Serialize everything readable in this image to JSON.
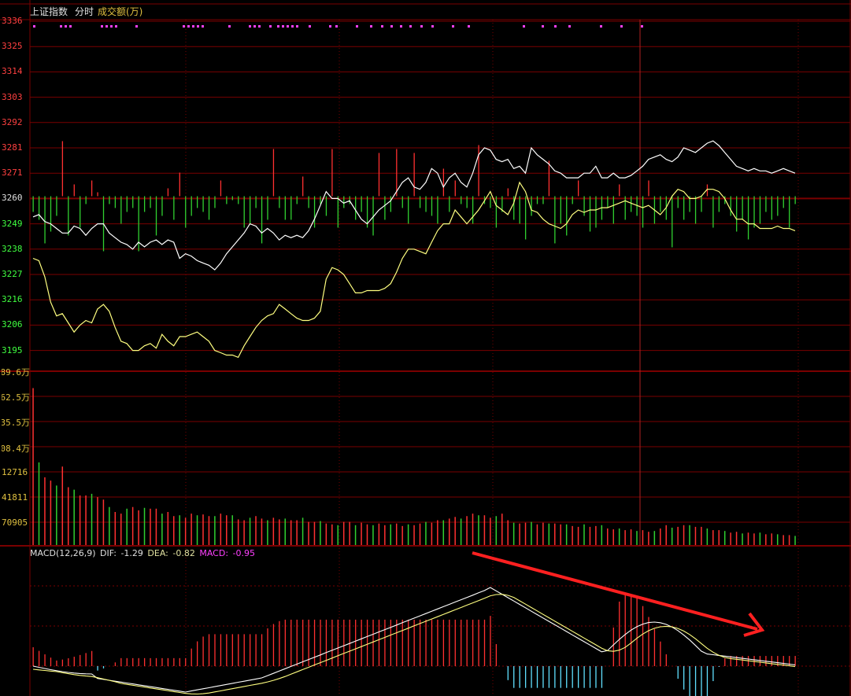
{
  "header": {
    "index_name": "上证指数",
    "mode": "分时",
    "volume_label": "成交额(万)"
  },
  "colors": {
    "background": "#000000",
    "grid": "#7a0000",
    "axis_red": "#ff4040",
    "axis_green": "#40ff40",
    "axis_yellow": "#e0c040",
    "price_line": "#ffffff",
    "avg_line": "#ffff80",
    "bar_up": "#ff3030",
    "bar_down": "#30d030",
    "macd_neg": "#60e0ff",
    "macd_pos": "#ff3030",
    "dots": "#ff40ff",
    "arrow": "#ff2020"
  },
  "macd_legend": {
    "name": "MACD(12,26,9)",
    "dif_label": "DIF:",
    "dif_value": "-1.29",
    "dea_label": "DEA:",
    "dea_value": "-0.82",
    "macd_label": "MACD:",
    "macd_value": "-0.95"
  },
  "chart_data": [
    {
      "type": "line",
      "panel": "price",
      "y_ticks": [
        "3336",
        "3325",
        "3314",
        "3303",
        "3292",
        "3281",
        "3271",
        "3260",
        "3249",
        "3238",
        "3227",
        "3216",
        "3206",
        "3195"
      ],
      "ylim": [
        3190,
        3336
      ],
      "base": 3260,
      "series": [
        {
          "role": "price_white",
          "values": [
            3251,
            3252,
            3249,
            3248,
            3246,
            3244,
            3244,
            3247,
            3246,
            3243,
            3246,
            3248,
            3248,
            3244,
            3242,
            3240,
            3239,
            3237,
            3240,
            3238,
            3240,
            3241,
            3239,
            3241,
            3240,
            3233,
            3235,
            3234,
            3232,
            3231,
            3230,
            3228,
            3231,
            3235,
            3238,
            3241,
            3244,
            3248,
            3247,
            3244,
            3246,
            3244,
            3241,
            3243,
            3242,
            3243,
            3242,
            3245,
            3250,
            3256,
            3262,
            3259,
            3259,
            3257,
            3258,
            3254,
            3250,
            3248,
            3251,
            3254,
            3256,
            3258,
            3262,
            3266,
            3268,
            3264,
            3263,
            3266,
            3272,
            3270,
            3264,
            3268,
            3270,
            3266,
            3264,
            3270,
            3278,
            3281,
            3280,
            3276,
            3275,
            3276,
            3272,
            3273,
            3270,
            3281,
            3278,
            3276,
            3274,
            3271,
            3270,
            3268,
            3268,
            3268,
            3270,
            3270,
            3273,
            3268,
            3268,
            3270,
            3268,
            3268,
            3269,
            3271,
            3273,
            3276,
            3277,
            3278,
            3276,
            3275,
            3277,
            3281,
            3280,
            3279,
            3281,
            3283,
            3284,
            3282,
            3279,
            3276,
            3273,
            3272,
            3271,
            3272,
            3271,
            3271,
            3270,
            3271,
            3272,
            3271,
            3270
          ]
        },
        {
          "role": "price_yellow",
          "values": [
            3233,
            3232,
            3225,
            3214,
            3208,
            3209,
            3205,
            3201,
            3204,
            3206,
            3205,
            3211,
            3213,
            3210,
            3203,
            3197,
            3196,
            3193,
            3193,
            3195,
            3196,
            3194,
            3200,
            3197,
            3195,
            3199,
            3199,
            3200,
            3201,
            3199,
            3197,
            3193,
            3192,
            3191,
            3191,
            3190,
            3195,
            3199,
            3203,
            3206,
            3208,
            3209,
            3213,
            3211,
            3209,
            3207,
            3206,
            3206,
            3207,
            3210,
            3224,
            3229,
            3228,
            3226,
            3222,
            3218,
            3218,
            3219,
            3219,
            3219,
            3220,
            3222,
            3227,
            3233,
            3237,
            3237,
            3236,
            3235,
            3240,
            3245,
            3248,
            3248,
            3254,
            3251,
            3248,
            3251,
            3254,
            3258,
            3262,
            3256,
            3254,
            3252,
            3257,
            3266,
            3262,
            3254,
            3253,
            3250,
            3248,
            3247,
            3246,
            3248,
            3252,
            3254,
            3253,
            3254,
            3254,
            3255,
            3255,
            3256,
            3257,
            3258,
            3257,
            3256,
            3255,
            3256,
            3254,
            3252,
            3255,
            3260,
            3263,
            3262,
            3259,
            3259,
            3260,
            3263,
            3263,
            3262,
            3259,
            3254,
            3250,
            3250,
            3248,
            3248,
            3246,
            3246,
            3246,
            3247,
            3246,
            3246,
            3245
          ]
        }
      ],
      "bars": [
        -4,
        -6,
        -12,
        -9,
        -5,
        14,
        -10,
        3,
        -8,
        -2,
        4,
        1,
        -14,
        -2,
        -3,
        -7,
        -4,
        -3,
        -14,
        -4,
        -3,
        -10,
        -5,
        2,
        -6,
        6,
        -8,
        -5,
        -3,
        -4,
        -6,
        -3,
        4,
        -2,
        -1,
        -2,
        -8,
        -7,
        -3,
        -12,
        -6,
        12,
        -3,
        -6,
        -6,
        -2,
        5,
        -3,
        -8,
        -2,
        -5,
        12,
        -8,
        -3,
        -2,
        -6,
        -4,
        -8,
        -10,
        11,
        -6,
        -4,
        12,
        -3,
        -7,
        11,
        -3,
        -4,
        -5,
        -7,
        7,
        -4,
        4,
        -2,
        -3,
        -7,
        13,
        -2,
        -3,
        -8,
        -4,
        2,
        -6,
        -7,
        -11,
        -5,
        -2,
        -2,
        9,
        -12,
        -7,
        -10,
        -2,
        4,
        -5,
        -9,
        -8,
        -6,
        -3,
        -7,
        3,
        -6,
        -4,
        -5,
        -8,
        4,
        -7,
        -4,
        -6,
        -13,
        -3,
        -6,
        -4,
        -7,
        -4,
        3,
        -8,
        -4,
        -2,
        -5,
        -9,
        -6,
        -11,
        -8,
        -7,
        -4,
        -6,
        -5,
        -3,
        -8,
        -2
      ]
    },
    {
      "type": "bar",
      "panel": "volume",
      "y_ticks": [
        "89.6万",
        "62.5万",
        "35.5万",
        "08.4万",
        "12716",
        "41811",
        "70905"
      ],
      "values": [
        190,
        100,
        82,
        78,
        72,
        95,
        70,
        67,
        60,
        60,
        62,
        58,
        55,
        46,
        40,
        38,
        44,
        46,
        42,
        45,
        44,
        44,
        38,
        40,
        35,
        36,
        33,
        38,
        36,
        37,
        35,
        35,
        38,
        36,
        36,
        31,
        30,
        33,
        35,
        32,
        30,
        33,
        31,
        32,
        30,
        30,
        33,
        28,
        28,
        29,
        26,
        25,
        24,
        28,
        28,
        24,
        27,
        25,
        24,
        26,
        24,
        25,
        26,
        23,
        25,
        24,
        26,
        28,
        27,
        30,
        30,
        32,
        34,
        32,
        35,
        38,
        36,
        36,
        33,
        35,
        38,
        30,
        27,
        26,
        27,
        28,
        25,
        27,
        26,
        26,
        25,
        25,
        23,
        22,
        25,
        22,
        23,
        24,
        20,
        19,
        20,
        18,
        19,
        17,
        18,
        16,
        17,
        20,
        24,
        21,
        22,
        24,
        24,
        22,
        22,
        20,
        18,
        18,
        17,
        15,
        16,
        14,
        15,
        14,
        15,
        13,
        14,
        13,
        12,
        12,
        11
      ],
      "ylim": [
        0,
        200
      ]
    },
    {
      "type": "bar",
      "panel": "macd",
      "dif": [
        -1.29
      ],
      "dea": [
        -0.82
      ],
      "macd": [
        -0.95
      ]
    }
  ]
}
